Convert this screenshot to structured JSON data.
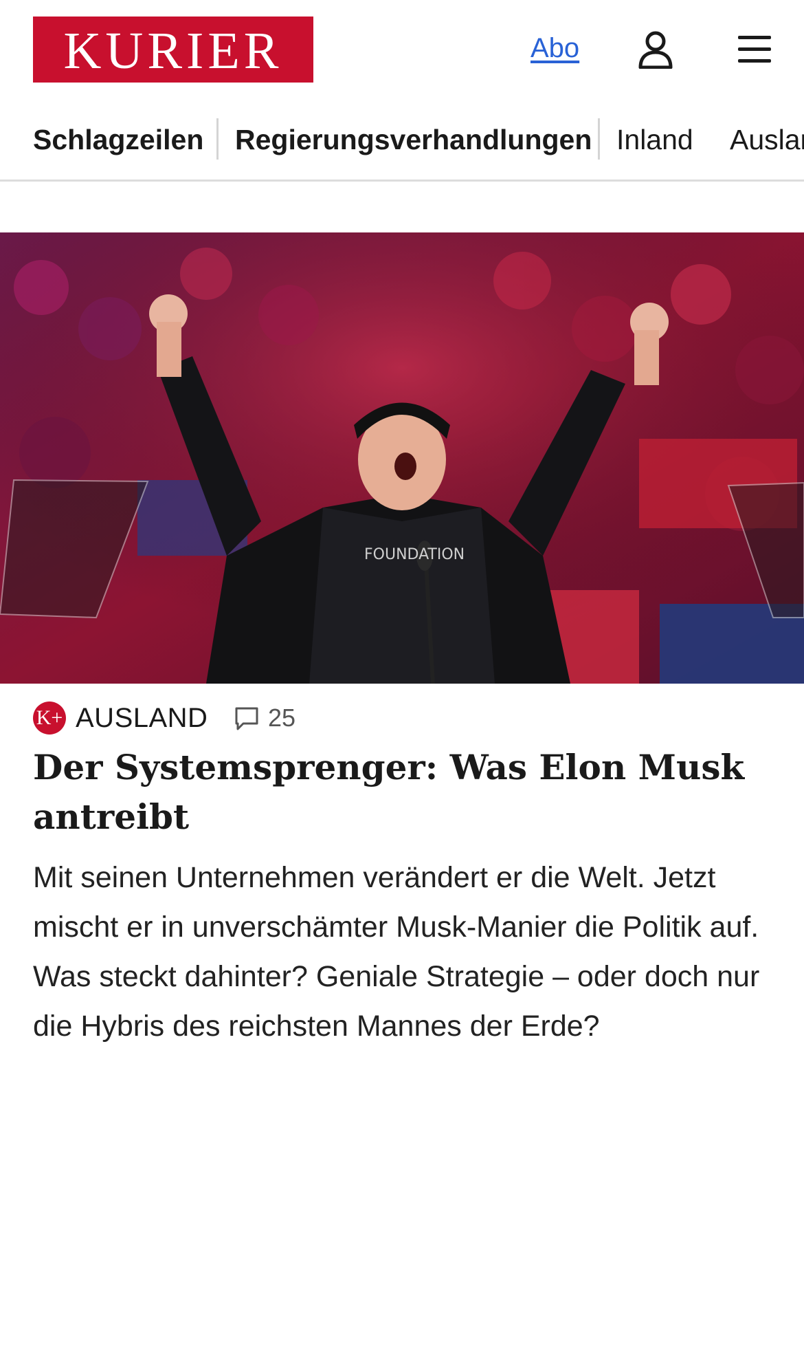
{
  "header": {
    "logo_text": "KURIER",
    "abo_label": "Abo",
    "user_icon": "user-icon",
    "menu_icon": "hamburger-menu-icon"
  },
  "nav": {
    "items": [
      {
        "label": "Schlagzeilen"
      },
      {
        "label": "Regierungsverhandlungen"
      },
      {
        "label": "Inland"
      },
      {
        "label": "Ausland"
      }
    ]
  },
  "article": {
    "badge_icon": "kplus-icon",
    "badge_text": "K+",
    "section": "AUSLAND",
    "comment_icon": "comment-icon",
    "comment_count": "25",
    "headline": "Der Systemsprenger: Was Elon Musk antreibt",
    "teaser": "Mit seinen Unternehmen verändert er die Welt. Jetzt mischt er in unverschämter Musk-Manier die Politik auf. Was steckt dahinter? Geniale Strategie – oder doch nur die Hybris des reichsten Mannes der Erde?"
  },
  "colors": {
    "brand_red": "#c8102e",
    "link_blue": "#2962d6"
  }
}
